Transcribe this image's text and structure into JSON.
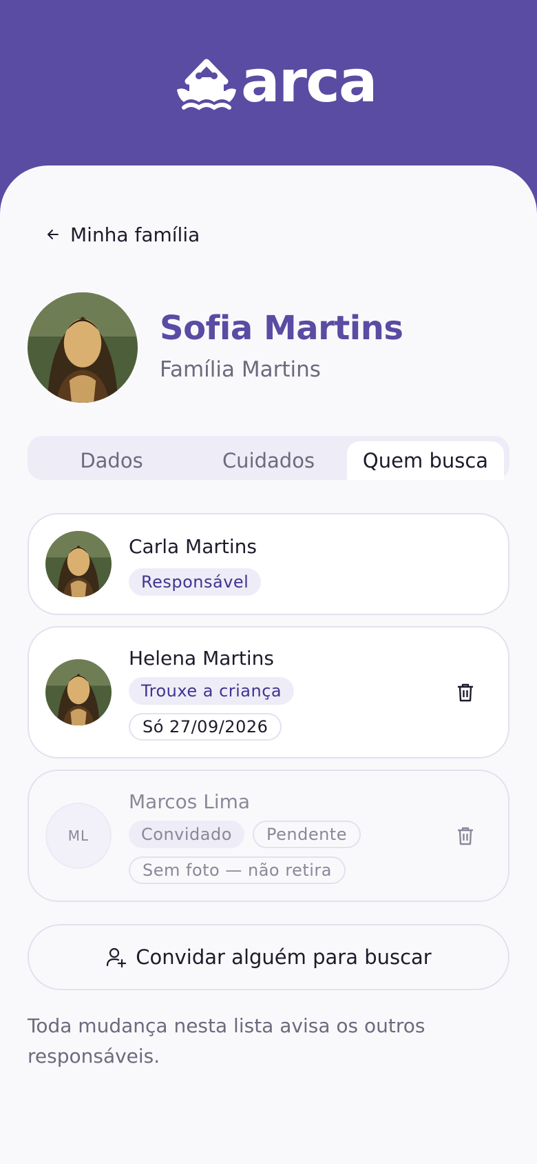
{
  "brand": {
    "name": "arca",
    "primary_color": "#5a4ba3"
  },
  "nav": {
    "back_label": "Minha família"
  },
  "profile": {
    "name": "Sofia Martins",
    "family": "Família Martins"
  },
  "tabs": [
    {
      "label": "Dados",
      "active": false
    },
    {
      "label": "Cuidados",
      "active": false
    },
    {
      "label": "Quem busca",
      "active": true
    }
  ],
  "pickups": [
    {
      "name": "Carla Martins",
      "chips": [
        "Responsável"
      ],
      "removable": false
    },
    {
      "name": "Helena Martins",
      "chips": [
        "Trouxe a criança",
        "Só 27/09/2026"
      ],
      "removable": true
    },
    {
      "name": "Marcos Lima",
      "initials": "ML",
      "chips": [
        "Convidado",
        "Pendente",
        "Sem foto — não retira"
      ],
      "removable": true
    }
  ],
  "invite": {
    "label": "Convidar alguém para buscar"
  },
  "footnote": "Toda mudança nesta lista avisa os outros responsáveis."
}
